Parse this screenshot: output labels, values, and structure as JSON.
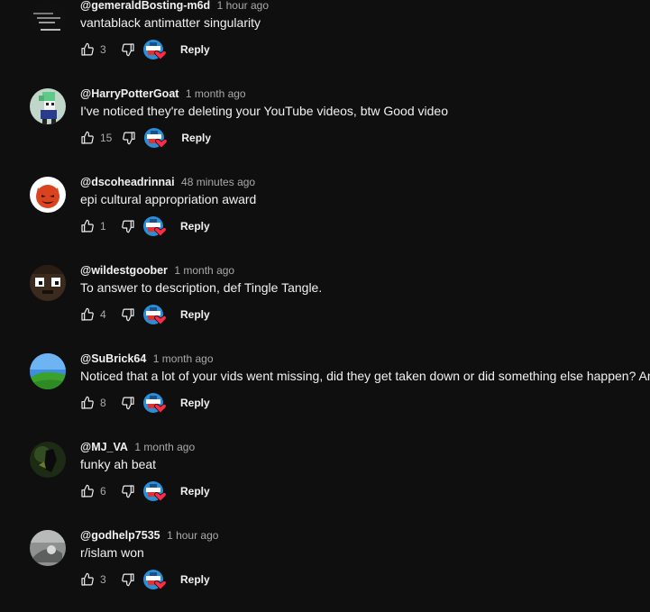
{
  "colors": {
    "background": "#0f0f0f",
    "text": "#f1f1f1",
    "secondary_text": "#aaaaaa",
    "heart": "#ff2b44"
  },
  "icons": {
    "like": "thumbs-up-icon",
    "dislike": "thumbs-down-icon",
    "creator_heart": "creator-heart-icon"
  },
  "reply_label": "Reply",
  "comments": [
    {
      "author": "@gemeraldBosting-m6d",
      "time": "1 hour ago",
      "text": "vantablack antimatter singularity",
      "likes": "3",
      "avatar": "dark-text-avatar"
    },
    {
      "author": "@HarryPotterGoat",
      "time": "1 month ago",
      "text": "I've noticed they're deleting your YouTube videos, btw Good video",
      "likes": "15",
      "avatar": "pixel-character-avatar"
    },
    {
      "author": "@dscoheadrinnai",
      "time": "48 minutes ago",
      "text": "epi cultural appropriation award",
      "likes": "1",
      "avatar": "red-devil-avatar"
    },
    {
      "author": "@wildestgoober",
      "time": "1 month ago",
      "text": "To answer to description, def Tingle Tangle.",
      "likes": "4",
      "avatar": "pixel-face-avatar"
    },
    {
      "author": "@SuBrick64",
      "time": "1 month ago",
      "text": "Noticed that a lot of your vids went missing, did they get taken down or did something else happen? An",
      "likes": "8",
      "avatar": "green-hill-avatar"
    },
    {
      "author": "@MJ_VA",
      "time": "1 month ago",
      "text": "funky ah beat",
      "likes": "6",
      "avatar": "dark-figure-avatar"
    },
    {
      "author": "@godhelp7535",
      "time": "1 hour ago",
      "text": "r/islam won",
      "likes": "3",
      "avatar": "grey-photo-avatar"
    }
  ]
}
